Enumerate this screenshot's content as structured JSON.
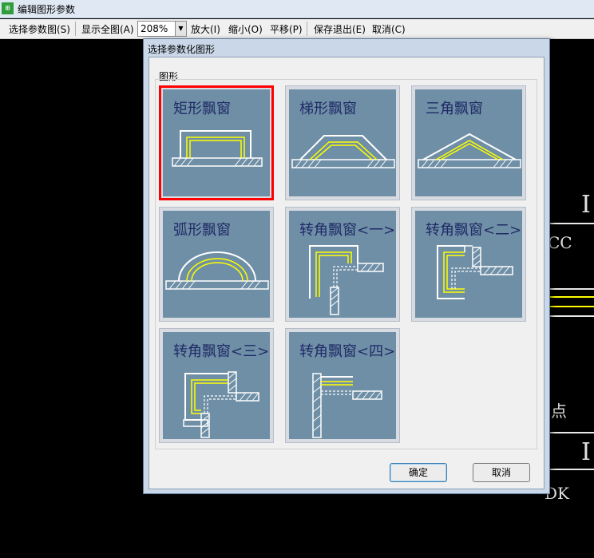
{
  "window": {
    "title": "编辑图形参数",
    "icon": "app-icon"
  },
  "toolbar": {
    "select": "选择参数图(S)",
    "show_all": "显示全图(A)",
    "zoom_value": "208%",
    "zoom_in": "放大(I)",
    "zoom_out": "缩小(O)",
    "pan": "平移(P)",
    "save_exit": "保存退出(E)",
    "cancel": "取消(C)"
  },
  "canvas": {
    "texts": [
      "CC",
      "点",
      "DK",
      "I",
      "I"
    ]
  },
  "dialog": {
    "title": "选择参数化图形",
    "group": "图形",
    "tiles": [
      {
        "label": "矩形飘窗",
        "selected": true
      },
      {
        "label": "梯形飘窗",
        "selected": false
      },
      {
        "label": "三角飘窗",
        "selected": false
      },
      {
        "label": "弧形飘窗",
        "selected": false
      },
      {
        "label": "转角飘窗<一>",
        "selected": false
      },
      {
        "label": "转角飘窗<二>",
        "selected": false
      },
      {
        "label": "转角飘窗<三>",
        "selected": false
      },
      {
        "label": "转角飘窗<四>",
        "selected": false
      }
    ],
    "ok": "确定",
    "cancel": "取消"
  },
  "colors": {
    "tile_bg": "#6f8fa6",
    "selection": "#ff0000",
    "label": "#1f2a66",
    "window_yellow": "#ffff00"
  }
}
